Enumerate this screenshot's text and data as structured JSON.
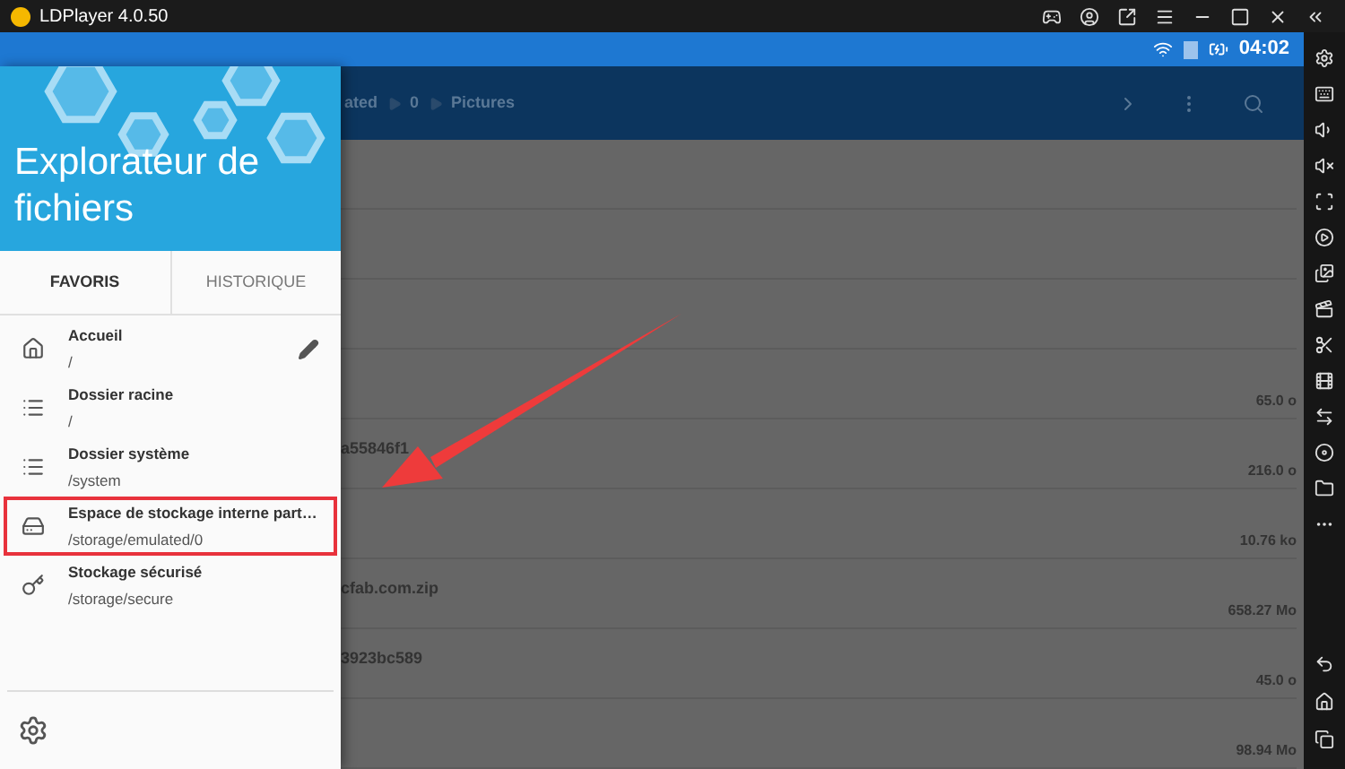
{
  "window": {
    "title": "LDPlayer 4.0.50"
  },
  "status_bar": {
    "time": "04:02"
  },
  "toolbar": {
    "breadcrumb": [
      "ated",
      "0",
      "Pictures"
    ]
  },
  "files": [
    {
      "size": "65.0 o"
    },
    {
      "name": "a55846f1",
      "size": "216.0 o"
    },
    {
      "size": "10.76 ko"
    },
    {
      "name": "cfab.com.zip",
      "size": "658.27 Mo"
    },
    {
      "name": "3923bc589",
      "size": "45.0 o"
    },
    {
      "size": "98.94 Mo"
    }
  ],
  "drawer": {
    "title": "Explorateur de fichiers",
    "tabs": [
      {
        "label": "FAVORIS",
        "selected": true
      },
      {
        "label": "HISTORIQUE",
        "selected": false
      }
    ],
    "items": [
      {
        "title": "Accueil",
        "path": "/",
        "editable": true,
        "highlighted": false
      },
      {
        "title": "Dossier racine",
        "path": "/",
        "editable": false,
        "highlighted": false
      },
      {
        "title": "Dossier système",
        "path": "/system",
        "editable": false,
        "highlighted": false
      },
      {
        "title": "Espace de stockage interne part…",
        "path": "/storage/emulated/0",
        "editable": false,
        "highlighted": true
      },
      {
        "title": "Stockage sécurisé",
        "path": "/storage/secure",
        "editable": false,
        "highlighted": false
      }
    ]
  }
}
